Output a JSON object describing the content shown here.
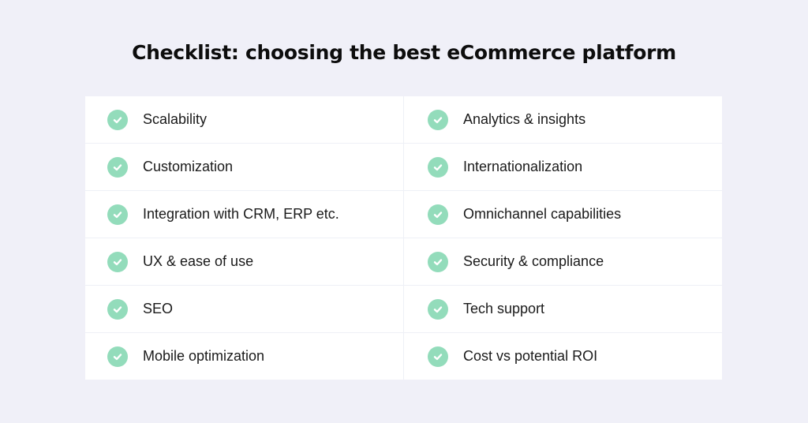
{
  "title": "Checklist: choosing the best eCommerce platform",
  "accent_color": "#93dcbb",
  "items": [
    {
      "label": "Scalability",
      "icon": "check-circle-icon",
      "checked": true
    },
    {
      "label": "Analytics & insights",
      "icon": "check-circle-icon",
      "checked": true
    },
    {
      "label": "Customization",
      "icon": "check-circle-icon",
      "checked": true
    },
    {
      "label": "Internationalization",
      "icon": "check-circle-icon",
      "checked": true
    },
    {
      "label": "Integration with CRM, ERP etc.",
      "icon": "check-circle-icon",
      "checked": true
    },
    {
      "label": "Omnichannel capabilities",
      "icon": "check-circle-icon",
      "checked": true
    },
    {
      "label": "UX & ease of use",
      "icon": "check-circle-icon",
      "checked": true
    },
    {
      "label": "Security & compliance",
      "icon": "check-circle-icon",
      "checked": true
    },
    {
      "label": "SEO",
      "icon": "check-circle-icon",
      "checked": true
    },
    {
      "label": "Tech support",
      "icon": "check-circle-icon",
      "checked": true
    },
    {
      "label": "Mobile optimization",
      "icon": "check-circle-icon",
      "checked": true
    },
    {
      "label": "Cost vs potential ROI",
      "icon": "check-circle-icon",
      "checked": true
    }
  ]
}
